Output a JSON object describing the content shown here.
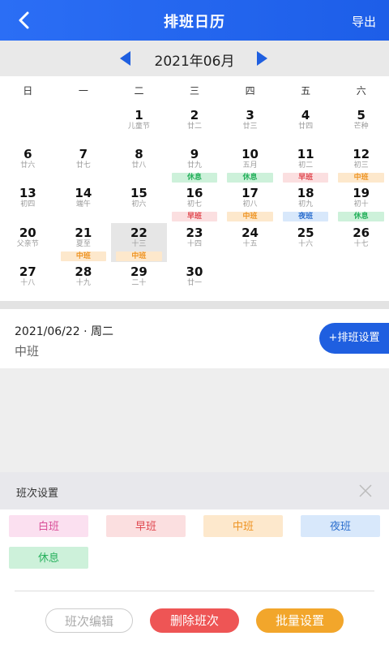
{
  "header": {
    "title": "排班日历",
    "export_label": "导出"
  },
  "month_nav": {
    "label": "2021年06月"
  },
  "weekdays": [
    "日",
    "一",
    "二",
    "三",
    "四",
    "五",
    "六"
  ],
  "shift_colors": {
    "白班": {
      "bg": "#fbe0f0",
      "fg": "#d94f98"
    },
    "早班": {
      "bg": "#fbdfe0",
      "fg": "#e0484f"
    },
    "中班": {
      "bg": "#fde8cc",
      "fg": "#ee9424"
    },
    "夜班": {
      "bg": "#d8e8fb",
      "fg": "#2d6fce"
    },
    "休息": {
      "bg": "#cdf1da",
      "fg": "#26b05c"
    }
  },
  "days": [
    {
      "num": "1",
      "lunar": "儿童节",
      "shift": ""
    },
    {
      "num": "2",
      "lunar": "廿二",
      "shift": ""
    },
    {
      "num": "3",
      "lunar": "廿三",
      "shift": ""
    },
    {
      "num": "4",
      "lunar": "廿四",
      "shift": ""
    },
    {
      "num": "5",
      "lunar": "芒种",
      "shift": ""
    },
    {
      "num": "6",
      "lunar": "廿六",
      "shift": ""
    },
    {
      "num": "7",
      "lunar": "廿七",
      "shift": ""
    },
    {
      "num": "8",
      "lunar": "廿八",
      "shift": ""
    },
    {
      "num": "9",
      "lunar": "廿九",
      "shift": "休息"
    },
    {
      "num": "10",
      "lunar": "五月",
      "shift": "休息"
    },
    {
      "num": "11",
      "lunar": "初二",
      "shift": "早班"
    },
    {
      "num": "12",
      "lunar": "初三",
      "shift": "中班"
    },
    {
      "num": "13",
      "lunar": "初四",
      "shift": ""
    },
    {
      "num": "14",
      "lunar": "端午",
      "shift": ""
    },
    {
      "num": "15",
      "lunar": "初六",
      "shift": ""
    },
    {
      "num": "16",
      "lunar": "初七",
      "shift": "早班"
    },
    {
      "num": "17",
      "lunar": "初八",
      "shift": "中班"
    },
    {
      "num": "18",
      "lunar": "初九",
      "shift": "夜班"
    },
    {
      "num": "19",
      "lunar": "初十",
      "shift": "休息"
    },
    {
      "num": "20",
      "lunar": "父亲节",
      "shift": ""
    },
    {
      "num": "21",
      "lunar": "夏至",
      "shift": "中班"
    },
    {
      "num": "22",
      "lunar": "十三",
      "shift": "中班",
      "selected": true
    },
    {
      "num": "23",
      "lunar": "十四",
      "shift": ""
    },
    {
      "num": "24",
      "lunar": "十五",
      "shift": ""
    },
    {
      "num": "25",
      "lunar": "十六",
      "shift": ""
    },
    {
      "num": "26",
      "lunar": "十七",
      "shift": ""
    },
    {
      "num": "27",
      "lunar": "十八",
      "shift": ""
    },
    {
      "num": "28",
      "lunar": "十九",
      "shift": ""
    },
    {
      "num": "29",
      "lunar": "二十",
      "shift": ""
    },
    {
      "num": "30",
      "lunar": "廿一",
      "shift": ""
    }
  ],
  "selected_detail": {
    "date": "2021/06/22 · 周二",
    "shift": "中班",
    "add_button": "+排班设置"
  },
  "panel": {
    "title": "班次设置",
    "shifts": [
      "白班",
      "早班",
      "中班",
      "夜班",
      "休息"
    ],
    "actions": {
      "edit": "班次编辑",
      "delete": "删除班次",
      "batch": "批量设置"
    }
  }
}
